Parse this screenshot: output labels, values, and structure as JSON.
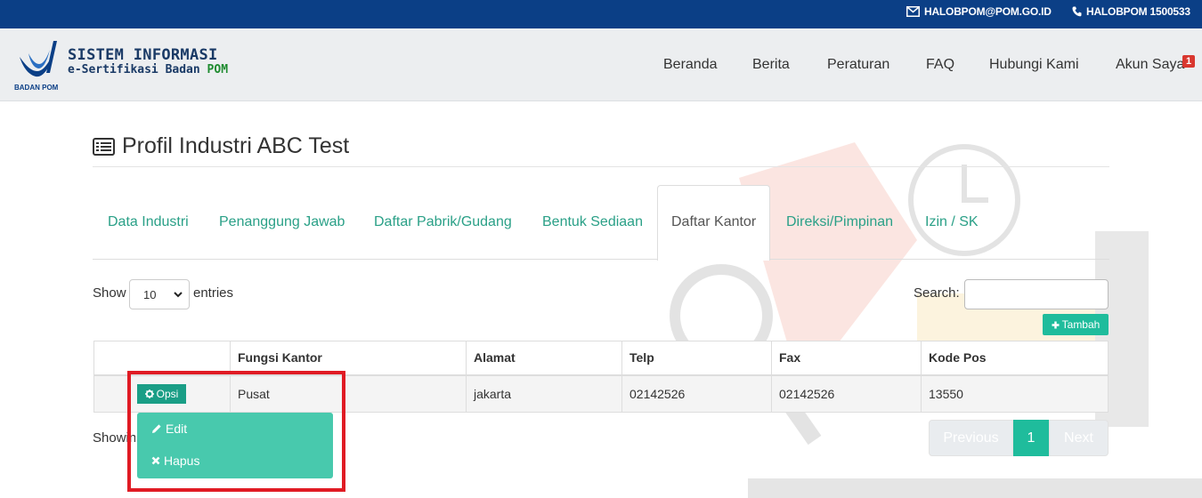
{
  "topbar": {
    "email": "HALOBPOM@POM.GO.ID",
    "phone": "HALOBPOM 1500533"
  },
  "brand": {
    "logo_caption": "BADAN POM",
    "line1": "SISTEM INFORMASI",
    "line2": "e-Sertifikasi Badan",
    "line2_highlight": "POM"
  },
  "nav": {
    "items": [
      "Beranda",
      "Berita",
      "Peraturan",
      "FAQ",
      "Hubungi Kami",
      "Akun Saya"
    ],
    "account_badge": "1"
  },
  "page": {
    "title": "Profil Industri ABC Test"
  },
  "tabs": [
    "Data Industri",
    "Penanggung Jawab",
    "Daftar Pabrik/Gudang",
    "Bentuk Sediaan",
    "Daftar Kantor",
    "Direksi/Pimpinan",
    "Izin / SK"
  ],
  "active_tab": "Daftar Kantor",
  "table_controls": {
    "show_label": "Show",
    "entries_value": "10",
    "entries_label": "entries",
    "search_label": "Search:",
    "add_button": "Tambah"
  },
  "table": {
    "headers": [
      "",
      "Fungsi Kantor",
      "Alamat",
      "Telp",
      "Fax",
      "Kode Pos"
    ],
    "rows": [
      {
        "fungsi": "Pusat",
        "alamat": "jakarta",
        "telp": "02142526",
        "fax": "02142526",
        "kode_pos": "13550"
      }
    ]
  },
  "row_menu": {
    "button": "Opsi",
    "items": [
      "Edit",
      "Hapus"
    ]
  },
  "footer": {
    "info": "Showing",
    "pagination": {
      "previous": "Previous",
      "current": "1",
      "next": "Next"
    }
  },
  "colors": {
    "topbar": "#0b3f86",
    "accent": "#1fbc9c",
    "tab_text": "#2aa087",
    "highlight_frame": "#e01b24"
  }
}
